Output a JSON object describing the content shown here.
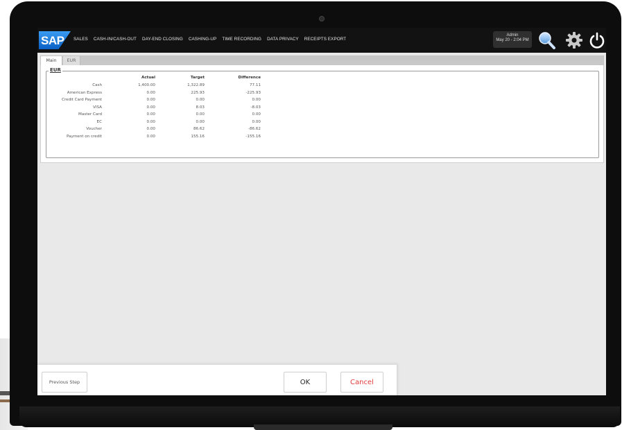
{
  "app": {
    "logo_text": "SAP"
  },
  "nav": {
    "items": [
      "SALES",
      "CASH-IN/CASH-OUT",
      "DAY-END CLOSING",
      "CASHING-UP",
      "TIME RECORDING",
      "DATA PRIVACY",
      "RECEIPTS EXPORT"
    ]
  },
  "user": {
    "name": "Admin",
    "datetime": "May 20 - 2:04 PM"
  },
  "icons": {
    "search": "search-icon",
    "settings": "gear-icon",
    "power": "power-icon"
  },
  "colors": {
    "accent_blue": "#1a73d9",
    "cancel_red": "#e23b3b",
    "topbar": "#121212"
  },
  "tabs": [
    {
      "label": "Main",
      "active": true
    },
    {
      "label": "EUR",
      "active": false
    }
  ],
  "section": {
    "legend": "EUR"
  },
  "table": {
    "headers": [
      "",
      "Actual",
      "Target",
      "Difference"
    ],
    "rows": [
      [
        "Cash",
        "1,400.00",
        "1,322.89",
        "77.11"
      ],
      [
        "American Express",
        "0.00",
        "225.93",
        "-225.93"
      ],
      [
        "Credit Card Payment",
        "0.00",
        "0.00",
        "0.00"
      ],
      [
        "VISA",
        "0.00",
        "8.03",
        "-8.03"
      ],
      [
        "Master Card",
        "0.00",
        "0.00",
        "0.00"
      ],
      [
        "EC",
        "0.00",
        "0.00",
        "0.00"
      ],
      [
        "Voucher",
        "0.00",
        "86.62",
        "-86.62"
      ],
      [
        "Payment on credit",
        "0.00",
        "155.16",
        "-155.16"
      ]
    ]
  },
  "actions": {
    "previous": "Previous Step",
    "ok": "OK",
    "cancel": "Cancel"
  }
}
